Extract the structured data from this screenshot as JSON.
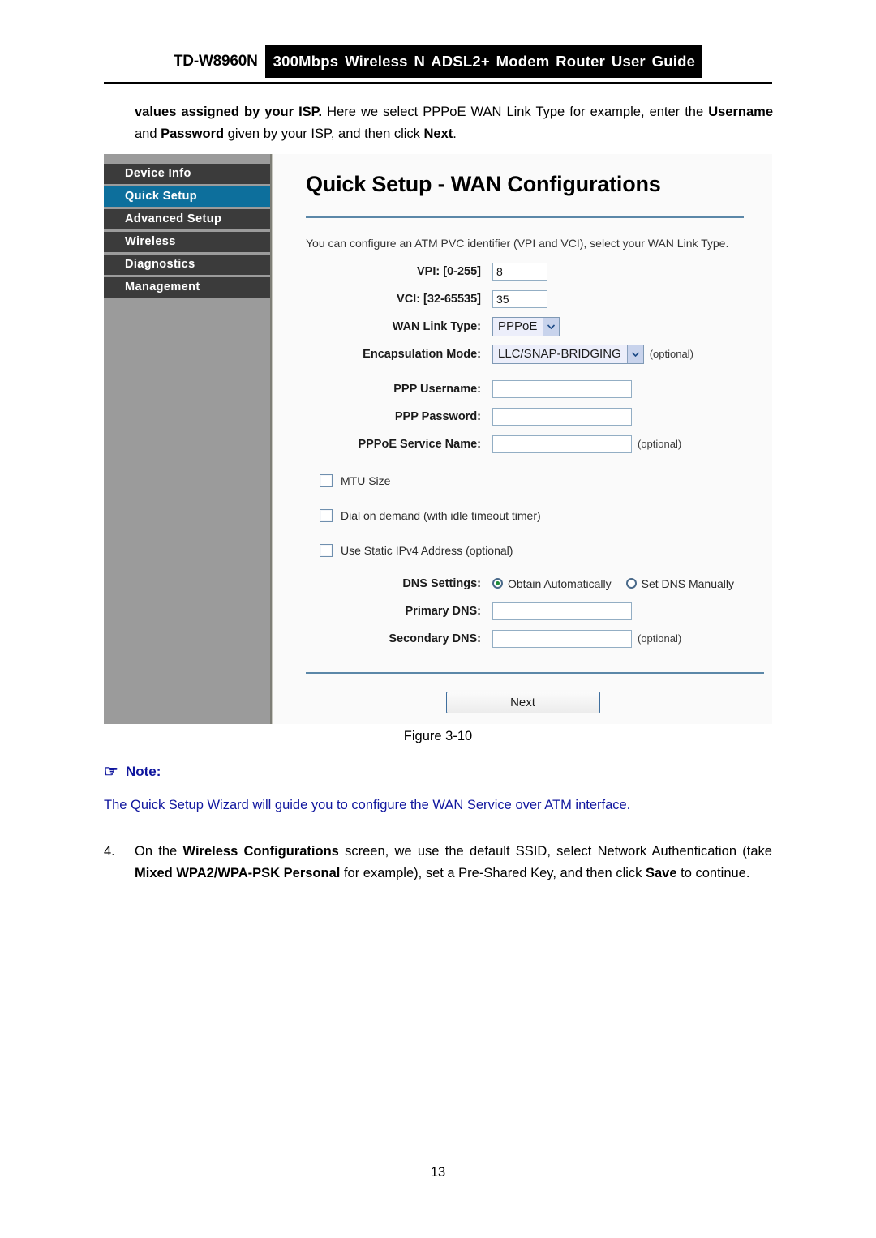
{
  "header": {
    "model": "TD-W8960N",
    "title": "300Mbps Wireless N ADSL2+ Modem Router User Guide"
  },
  "intro": {
    "bold1": "values assigned by your ISP.",
    "text1": " Here we select PPPoE WAN Link Type for example, enter the ",
    "bold2": "Username",
    "text2": " and ",
    "bold3": "Password",
    "text3": " given by your ISP, and then click ",
    "bold4": "Next",
    "text4": "."
  },
  "screenshot": {
    "sidebar": {
      "items": [
        {
          "label": "Device Info",
          "active": false
        },
        {
          "label": "Quick Setup",
          "active": true
        },
        {
          "label": "Advanced Setup",
          "active": false
        },
        {
          "label": "Wireless",
          "active": false
        },
        {
          "label": "Diagnostics",
          "active": false
        },
        {
          "label": "Management",
          "active": false
        }
      ],
      "active_color": "#0d6f9c",
      "item_color": "#3b3b3b",
      "background_color": "#9b9b9b"
    },
    "panel": {
      "title": "Quick Setup - WAN Configurations",
      "description": "You can configure an ATM PVC identifier (VPI and VCI), select your WAN Link Type.",
      "fields": {
        "vpi_label": "VPI: [0-255]",
        "vpi_value": "8",
        "vci_label": "VCI: [32-65535]",
        "vci_value": "35",
        "wan_link_type_label": "WAN Link Type:",
        "wan_link_type_value": "PPPoE",
        "encapsulation_label": "Encapsulation Mode:",
        "encapsulation_value": "LLC/SNAP-BRIDGING",
        "encapsulation_optional": "(optional)",
        "ppp_username_label": "PPP Username:",
        "ppp_username_value": "",
        "ppp_password_label": "PPP Password:",
        "ppp_password_value": "",
        "pppoe_service_label": "PPPoE Service Name:",
        "pppoe_service_value": "",
        "pppoe_service_optional": "(optional)"
      },
      "checkboxes": [
        {
          "label": "MTU Size",
          "checked": false
        },
        {
          "label": "Dial on demand (with idle timeout timer)",
          "checked": false
        },
        {
          "label": "Use Static IPv4 Address  (optional)",
          "checked": false
        }
      ],
      "dns": {
        "settings_label": "DNS Settings:",
        "radio_auto": "Obtain Automatically",
        "radio_manual": "Set DNS Manually",
        "selected": "Obtain Automatically",
        "primary_label": "Primary DNS:",
        "primary_value": "",
        "secondary_label": "Secondary DNS:",
        "secondary_value": "",
        "secondary_optional": "(optional)"
      },
      "next_button": "Next"
    }
  },
  "caption": "Figure 3-10",
  "note": {
    "icon": "pointing-hand-icon",
    "heading": "Note:",
    "body": "The Quick Setup Wizard will guide you to configure the WAN Service over ATM interface.",
    "color": "#10169e"
  },
  "step": {
    "number": "4.",
    "t1": "On the ",
    "b1": "Wireless Configurations",
    "t2": " screen, we use the default SSID, select Network Authentication (take ",
    "b2": "Mixed WPA2/WPA-PSK Personal",
    "t3": " for example), set a Pre-Shared Key, and then click ",
    "b3": "Save",
    "t4": " to continue."
  },
  "page_number": "13"
}
